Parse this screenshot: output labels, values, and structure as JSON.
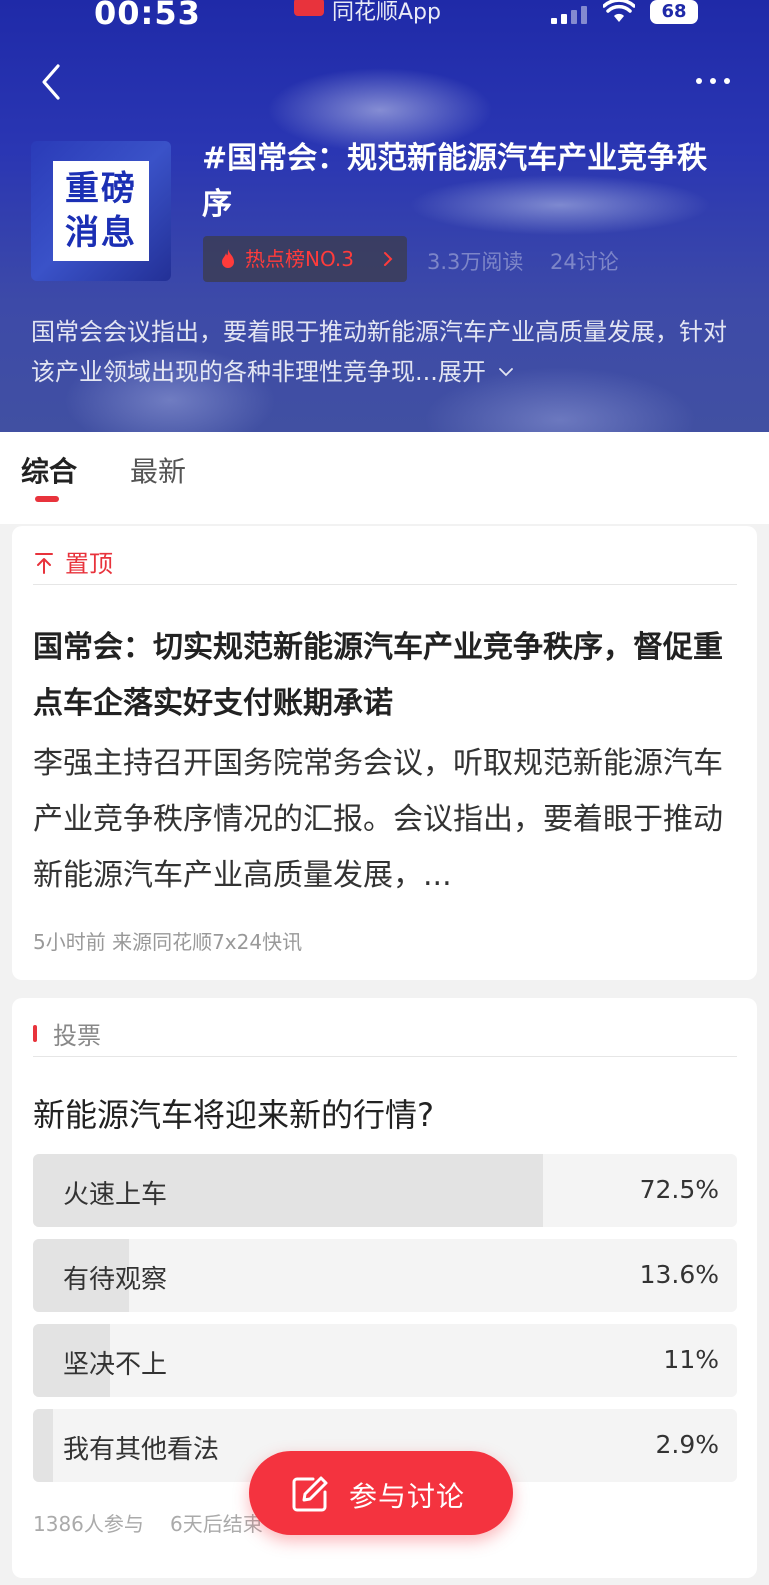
{
  "status_bar": {
    "time": "00:53",
    "app_name": "同花顺App",
    "battery": "68"
  },
  "header": {
    "topic_title": "#国常会：规范新能源汽车产业竞争秩序",
    "cover_line1": "重磅",
    "cover_line2": "消息",
    "hot_badge": "热点榜NO.3",
    "reads": "3.3万阅读",
    "discussions": "24讨论",
    "description": "国常会会议指出，要着眼于推动新能源汽车产业高质量发展，针对该产业领域出现的各种非理性竞争现...",
    "expand_label": "展开"
  },
  "tabs": [
    {
      "label": "综合",
      "active": true
    },
    {
      "label": "最新",
      "active": false
    }
  ],
  "pinned": {
    "label": "置顶",
    "title": "国常会：切实规范新能源汽车产业竞争秩序，督促重点车企落实好支付账期承诺",
    "summary": "李强主持召开国务院常务会议，听取规范新能源汽车产业竞争秩序情况的汇报。会议指出，要着眼于推动新能源汽车产业高质量发展，...",
    "meta": "5小时前 来源同花顺7x24快讯"
  },
  "vote": {
    "label": "投票",
    "question": "新能源汽车将迎来新的行情?",
    "options": [
      {
        "label": "火速上车",
        "percent": "72.5%",
        "fraction": 0.725
      },
      {
        "label": "有待观察",
        "percent": "13.6%",
        "fraction": 0.136
      },
      {
        "label": "坚决不上",
        "percent": "11%",
        "fraction": 0.11
      },
      {
        "label": "我有其他看法",
        "percent": "2.9%",
        "fraction": 0.029
      }
    ],
    "participants": "1386人参与",
    "ends": "6天后结束"
  },
  "fab": {
    "label": "参与讨论"
  },
  "colors": {
    "accent": "#e8333c",
    "header_blue": "#1f2aa8"
  }
}
